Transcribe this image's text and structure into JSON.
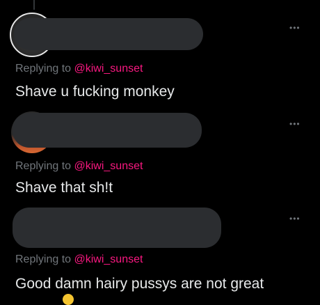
{
  "replies": [
    {
      "replying_prefix": "Replying to",
      "handle": "@kiwi_sunset",
      "text": "Shave u fucking monkey",
      "more_icon": "more-horizontal-icon"
    },
    {
      "replying_prefix": "Replying to",
      "handle": "@kiwi_sunset",
      "text": "Shave that sh!t",
      "more_icon": "more-horizontal-icon"
    },
    {
      "replying_prefix": "Replying to",
      "handle": "@kiwi_sunset",
      "text": "Good damn hairy pussys are not great",
      "more_icon": "more-horizontal-icon"
    }
  ],
  "colors": {
    "background": "#000000",
    "text": "#e7e9ea",
    "secondary_text": "#71767b",
    "handle_accent": "#f91880",
    "redaction": "#2b2d30"
  }
}
